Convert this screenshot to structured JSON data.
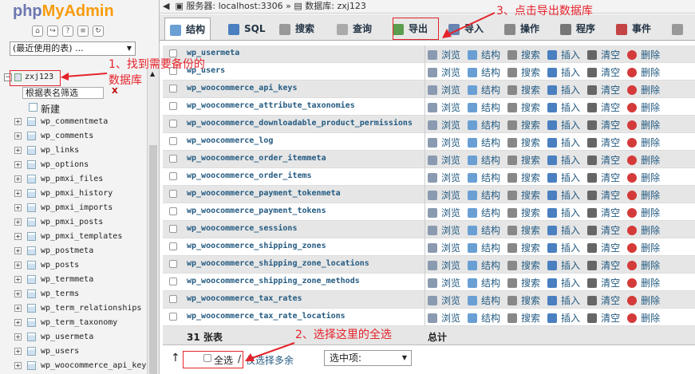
{
  "left": {
    "logo_php": "php",
    "logo_admin": "MyAdmin",
    "recent_select": "(最近使用的表) ...",
    "database": "zxj123",
    "filter_placeholder": "根据表名筛选",
    "filter_clear": "X",
    "new_label": "新建",
    "tables": [
      "wp_commentmeta",
      "wp_comments",
      "wp_links",
      "wp_options",
      "wp_pmxi_files",
      "wp_pmxi_history",
      "wp_pmxi_imports",
      "wp_pmxi_posts",
      "wp_pmxi_templates",
      "wp_postmeta",
      "wp_posts",
      "wp_termmeta",
      "wp_terms",
      "wp_term_relationships",
      "wp_term_taxonomy",
      "wp_usermeta",
      "wp_users",
      "wp_woocommerce_api_key"
    ]
  },
  "header": {
    "breadcrumb_server": "服务器: localhost:3306",
    "breadcrumb_sep": "»",
    "breadcrumb_db": "数据库: zxj123"
  },
  "tabs": [
    {
      "label": "结构",
      "color": "#6a9fd4"
    },
    {
      "label": "SQL",
      "color": "#4a7fc0"
    },
    {
      "label": "搜索",
      "color": "#999999"
    },
    {
      "label": "查询",
      "color": "#aaaaaa"
    },
    {
      "label": "导出",
      "color": "#5b9e4f"
    },
    {
      "label": "导入",
      "color": "#6a84b0"
    },
    {
      "label": "操作",
      "color": "#888888"
    },
    {
      "label": "程序",
      "color": "#777777"
    },
    {
      "label": "事件",
      "color": "#c44444"
    }
  ],
  "rows": [
    "wp_usermeta",
    "wp_users",
    "wp_woocommerce_api_keys",
    "wp_woocommerce_attribute_taxonomies",
    "wp_woocommerce_downloadable_product_permissions",
    "wp_woocommerce_log",
    "wp_woocommerce_order_itemmeta",
    "wp_woocommerce_order_items",
    "wp_woocommerce_payment_tokenmeta",
    "wp_woocommerce_payment_tokens",
    "wp_woocommerce_sessions",
    "wp_woocommerce_shipping_zones",
    "wp_woocommerce_shipping_zone_locations",
    "wp_woocommerce_shipping_zone_methods",
    "wp_woocommerce_tax_rates",
    "wp_woocommerce_tax_rate_locations"
  ],
  "actions": [
    "浏览",
    "结构",
    "搜索",
    "插入",
    "清空",
    "删除"
  ],
  "summary": {
    "count": "31 张表",
    "total": "总计"
  },
  "bottom": {
    "check_all": "全选",
    "slash": "/",
    "check_overhead": "仅选择多余",
    "with_selected": "选中项:"
  },
  "annotations": {
    "note1_line1": "1、找到需要备份的",
    "note1_line2": "数据库",
    "note2": "2、选择这里的全选",
    "note3": "3、点击导出数据库"
  },
  "colors": {
    "accent_red": "#e4232b",
    "link_blue": "#235a81"
  }
}
